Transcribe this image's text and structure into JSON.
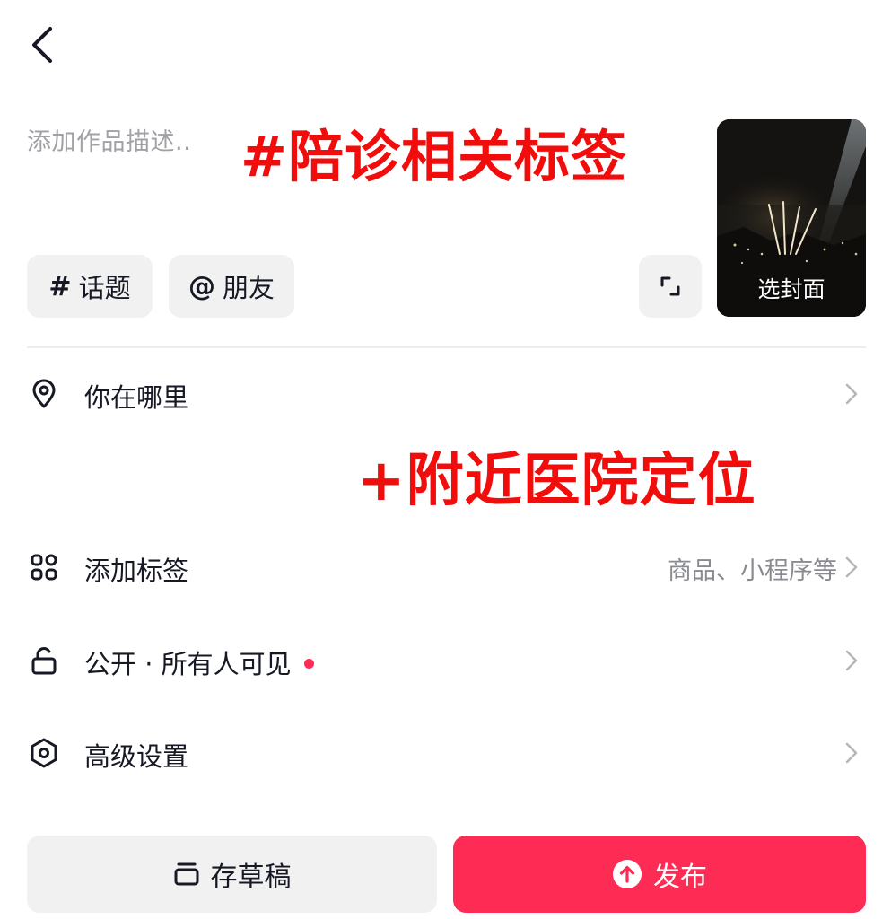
{
  "header": {
    "back_icon": "chevron-left-icon"
  },
  "description": {
    "placeholder": "添加作品描述.."
  },
  "overlays": {
    "tag_hint": "#陪诊相关标签",
    "location_hint": "+附近医院定位"
  },
  "chips": {
    "topic_symbol": "#",
    "topic_label": "话题",
    "friend_symbol": "@",
    "friend_label": "朋友"
  },
  "cover": {
    "label": "选封面"
  },
  "rows": {
    "location": {
      "label": "你在哪里",
      "icon": "location-pin-icon"
    },
    "tags": {
      "label": "添加标签",
      "value": "商品、小程序等",
      "icon": "grid-icon"
    },
    "visibility": {
      "label": "公开 · 所有人可见",
      "icon": "unlock-icon",
      "has_dot": true
    },
    "advanced": {
      "label": "高级设置",
      "icon": "settings-hex-icon"
    }
  },
  "actions": {
    "draft_label": "存草稿",
    "publish_label": "发布"
  },
  "colors": {
    "accent": "#fe2c55",
    "overlay_red": "#f20d0d",
    "chip_bg": "#f1f1f2",
    "muted_text": "#8a8b91"
  }
}
